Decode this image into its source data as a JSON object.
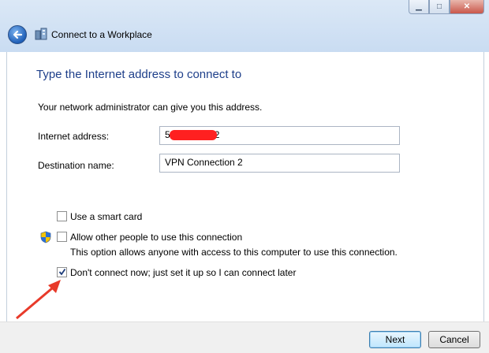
{
  "window": {
    "title": "Connect to a Workplace",
    "minimize_glyph": "▁",
    "maximize_glyph": "□",
    "close_glyph": "✕"
  },
  "main": {
    "heading": "Type the Internet address to connect to",
    "description": "Your network administrator can give you this address.",
    "internet_address": {
      "label": "Internet address:",
      "value_start": "5",
      "value_end": "2"
    },
    "destination_name": {
      "label": "Destination name:",
      "value": "VPN Connection 2"
    },
    "options": [
      {
        "label": "Use a smart card",
        "checked": false
      },
      {
        "label": "Allow other people to use this connection",
        "checked": false,
        "note": "This option allows anyone with access to this computer to use this connection."
      },
      {
        "label": "Don't connect now; just set it up so I can connect later",
        "checked": true
      }
    ]
  },
  "footer": {
    "next_label": "Next",
    "cancel_label": "Cancel"
  },
  "colors": {
    "heading": "#1e3f8a",
    "redaction": "#ff2020",
    "arrow": "#e83a2a"
  },
  "icons": [
    "back-arrow-icon",
    "workplace-icon",
    "uac-shield-icon",
    "checkmark-icon"
  ]
}
